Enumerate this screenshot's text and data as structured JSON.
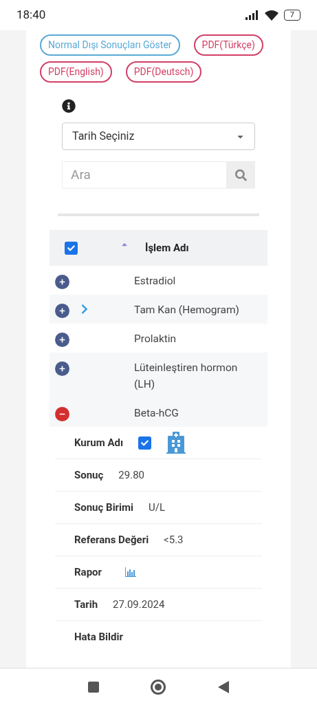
{
  "status_bar": {
    "time": "18:40",
    "battery": "7"
  },
  "action_buttons": [
    {
      "label": "Normal Dışı Sonuçları Göster",
      "color": "#5aa9d6"
    },
    {
      "label": "PDF(Türkçe)",
      "color": "#d23f66"
    },
    {
      "label": "PDF(English)",
      "color": "#d23f66"
    },
    {
      "label": "PDF(Deutsch)",
      "color": "#d23f66"
    }
  ],
  "date_select": {
    "value": "Tarih Seçiniz"
  },
  "search": {
    "placeholder": "Ara"
  },
  "table": {
    "header": {
      "checked": true,
      "label": "İşlem Adı"
    },
    "rows": [
      {
        "name": "Estradiol",
        "expanded": false,
        "chevron": false
      },
      {
        "name": "Tam Kan (Hemogram)",
        "expanded": false,
        "chevron": true
      },
      {
        "name": "Prolaktin",
        "expanded": false,
        "chevron": false
      },
      {
        "name": "Lüteinleştiren hormon (LH)",
        "expanded": false,
        "chevron": false
      },
      {
        "name": "Beta-hCG",
        "expanded": true,
        "chevron": false
      }
    ],
    "details": [
      {
        "kind": "checkbox",
        "label": "Kurum Adı",
        "checked": true
      },
      {
        "kind": "text",
        "label": "Sonuç",
        "value": "29.80"
      },
      {
        "kind": "text",
        "label": "Sonuç Birimi",
        "value": "U/L"
      },
      {
        "kind": "text",
        "label": "Referans Değeri",
        "value": "<5.3"
      },
      {
        "kind": "chart",
        "label": "Rapor"
      },
      {
        "kind": "text",
        "label": "Tarih",
        "value": "27.09.2024"
      },
      {
        "kind": "empty",
        "label": "Hata Bildir"
      }
    ]
  }
}
